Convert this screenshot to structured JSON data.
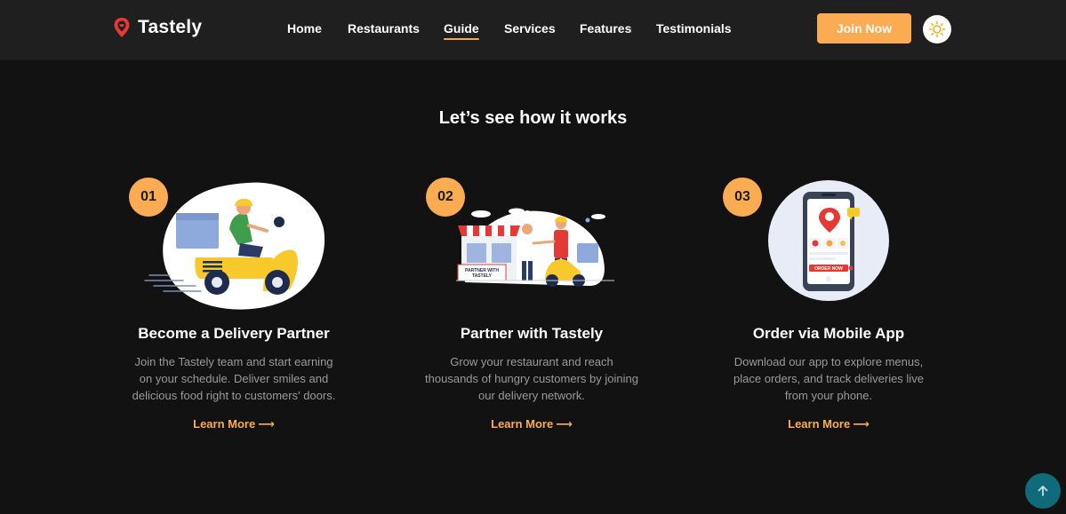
{
  "brand": {
    "name": "Tastely",
    "icon": "location-pin-icon",
    "accent": "#e53935"
  },
  "nav": {
    "items": [
      {
        "label": "Home",
        "active": false
      },
      {
        "label": "Restaurants",
        "active": false
      },
      {
        "label": "Guide",
        "active": true
      },
      {
        "label": "Services",
        "active": false
      },
      {
        "label": "Features",
        "active": false
      },
      {
        "label": "Testimonials",
        "active": false
      }
    ],
    "join_label": "Join Now",
    "theme_icon": "sun-icon"
  },
  "section": {
    "title": "Let’s see how it works"
  },
  "steps": [
    {
      "number": "01",
      "title": "Become a Delivery Partner",
      "description": "Join the Tastely team and start earning on your schedule. Deliver smiles and delicious food right to customers' doors.",
      "link": "Learn More",
      "illustration": "delivery-scooter-illustration"
    },
    {
      "number": "02",
      "title": "Partner with Tastely",
      "description": "Grow your restaurant and reach thousands of hungry customers by joining our delivery network.",
      "link": "Learn More",
      "illustration": "restaurant-partner-illustration",
      "storefront_sign": [
        "PARTNER WITH",
        "TASTELY"
      ]
    },
    {
      "number": "03",
      "title": "Order via Mobile App",
      "description": "Download our app to explore menus, place orders, and track deliveries live from your phone.",
      "link": "Learn More",
      "illustration": "mobile-app-illustration",
      "phone_button": "ORDER NOW"
    }
  ],
  "scroll_top_icon": "arrow-up-icon",
  "colors": {
    "background": "#121212",
    "navbar": "#1f1f1f",
    "accent": "#fbac52",
    "text_muted": "#9a9a9a",
    "scroll_button": "#0f6a79"
  }
}
